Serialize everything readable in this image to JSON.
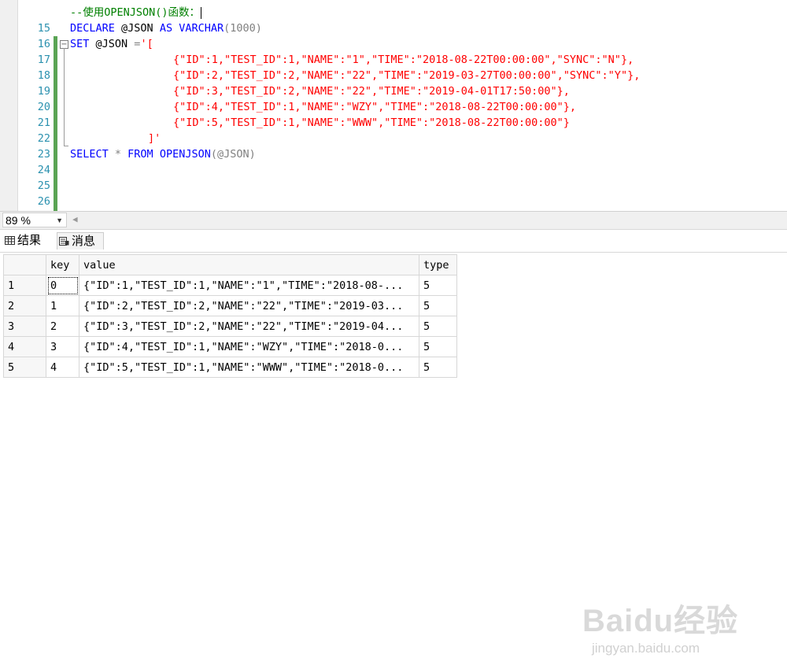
{
  "editor": {
    "lines": [
      {
        "num": "15",
        "comment": "--使用OPENJSON()函数："
      },
      {
        "num": "16",
        "kw1": "DECLARE",
        "var": " @JSON ",
        "kw2": "AS",
        "kw3": " VARCHAR",
        "rest": "(1000)"
      },
      {
        "num": "17",
        "kw1": "SET",
        "var": " @JSON ",
        "op": "=",
        "str": "'["
      },
      {
        "num": "18",
        "str": "{\"ID\":1,\"TEST_ID\":1,\"NAME\":\"1\",\"TIME\":\"2018-08-22T00:00:00\",\"SYNC\":\"N\"},"
      },
      {
        "num": "19",
        "str": "{\"ID\":2,\"TEST_ID\":2,\"NAME\":\"22\",\"TIME\":\"2019-03-27T00:00:00\",\"SYNC\":\"Y\"},"
      },
      {
        "num": "20",
        "str": "{\"ID\":3,\"TEST_ID\":2,\"NAME\":\"22\",\"TIME\":\"2019-04-01T17:50:00\"},"
      },
      {
        "num": "21",
        "str": "{\"ID\":4,\"TEST_ID\":1,\"NAME\":\"WZY\",\"TIME\":\"2018-08-22T00:00:00\"},"
      },
      {
        "num": "22",
        "str": "{\"ID\":5,\"TEST_ID\":1,\"NAME\":\"WWW\",\"TIME\":\"2018-08-22T00:00:00\"}"
      },
      {
        "num": "23",
        "str": "]'"
      },
      {
        "num": "24",
        "kw1": "SELECT",
        "op": " * ",
        "kw2": "FROM",
        "fn": " OPENJSON",
        "rest": "(@JSON)"
      },
      {
        "num": "25"
      },
      {
        "num": "26"
      }
    ]
  },
  "zoom": {
    "value": "89 %"
  },
  "tabs": {
    "results": "结果",
    "messages": "消息"
  },
  "grid": {
    "headers": [
      "key",
      "value",
      "type"
    ],
    "rows": [
      {
        "n": "1",
        "key": "0",
        "value": "{\"ID\":1,\"TEST_ID\":1,\"NAME\":\"1\",\"TIME\":\"2018-08-...",
        "type": "5"
      },
      {
        "n": "2",
        "key": "1",
        "value": "{\"ID\":2,\"TEST_ID\":2,\"NAME\":\"22\",\"TIME\":\"2019-03...",
        "type": "5"
      },
      {
        "n": "3",
        "key": "2",
        "value": "{\"ID\":3,\"TEST_ID\":2,\"NAME\":\"22\",\"TIME\":\"2019-04...",
        "type": "5"
      },
      {
        "n": "4",
        "key": "3",
        "value": "{\"ID\":4,\"TEST_ID\":1,\"NAME\":\"WZY\",\"TIME\":\"2018-0...",
        "type": "5"
      },
      {
        "n": "5",
        "key": "4",
        "value": "{\"ID\":5,\"TEST_ID\":1,\"NAME\":\"WWW\",\"TIME\":\"2018-0...",
        "type": "5"
      }
    ]
  },
  "watermark": {
    "logo": "Baidu经验",
    "url": "jingyan.baidu.com"
  },
  "colors": {
    "keyword": "#0000ff",
    "string": "#ff0000",
    "comment": "#008000",
    "function": "#ff00ff",
    "line_number": "#2b91af",
    "change_bar": "#5aa454"
  }
}
